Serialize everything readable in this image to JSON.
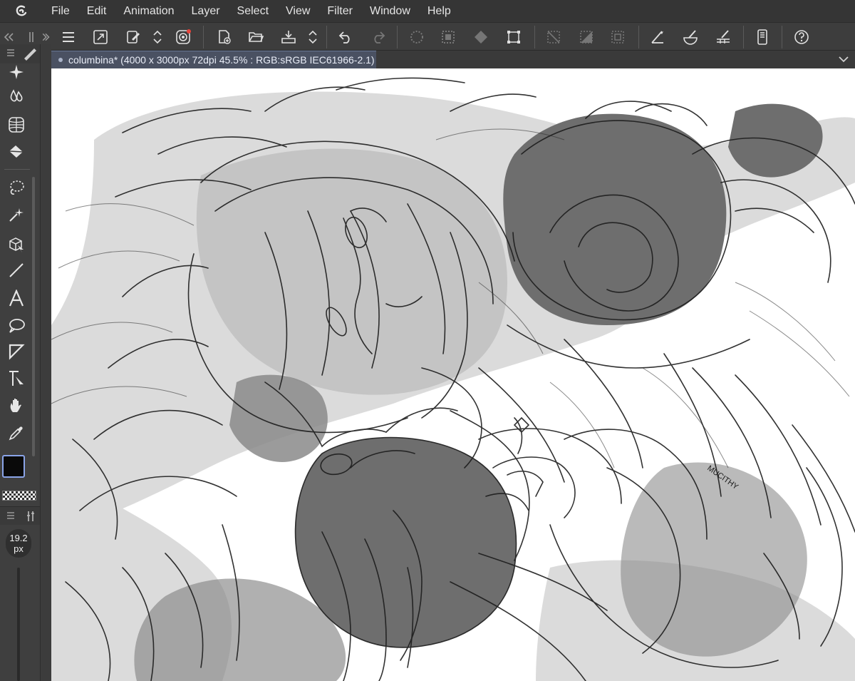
{
  "menu": {
    "items": [
      "File",
      "Edit",
      "Animation",
      "Layer",
      "Select",
      "View",
      "Filter",
      "Window",
      "Help"
    ]
  },
  "toolbar": {
    "icons": [
      "menu-icon",
      "canvas-resize-icon",
      "edit-settings-icon",
      "expand-collapse-icon",
      "timelapse-icon",
      "new-canvas-icon",
      "open-folder-icon",
      "save-icon",
      "expand-collapse-icon",
      "undo-icon",
      "redo-icon",
      "clear-icon",
      "deselect-icon",
      "fill-icon",
      "transform-icon",
      "show-selection-icon",
      "crop-icon",
      "selection-area-icon",
      "ruler-snap-icon",
      "special-ruler-icon",
      "grid-ruler-icon",
      "device-settings-icon",
      "help-icon"
    ]
  },
  "tools": {
    "icons": [
      "sparkle-tool-icon",
      "blend-tool-icon",
      "mesh-tool-icon",
      "fill-bucket-icon",
      "lasso-icon",
      "auto-select-icon",
      "3d-object-icon",
      "line-tool-icon",
      "text-tool-icon",
      "balloon-tool-icon",
      "frame-border-icon",
      "correct-line-icon",
      "hand-tool-icon",
      "eyedropper-icon"
    ]
  },
  "colors": {
    "main": "#0a0a0a",
    "sub": "#c6c6c6",
    "accent": "#8aa4e8"
  },
  "brush": {
    "size_value": "19.2",
    "size_unit": "px"
  },
  "canvas": {
    "tab_title": "columbina* (4000 x 3000px 72dpi 45.5% : RGB:sRGB IEC61966-2.1)",
    "signature_text": "MUCITHY"
  }
}
